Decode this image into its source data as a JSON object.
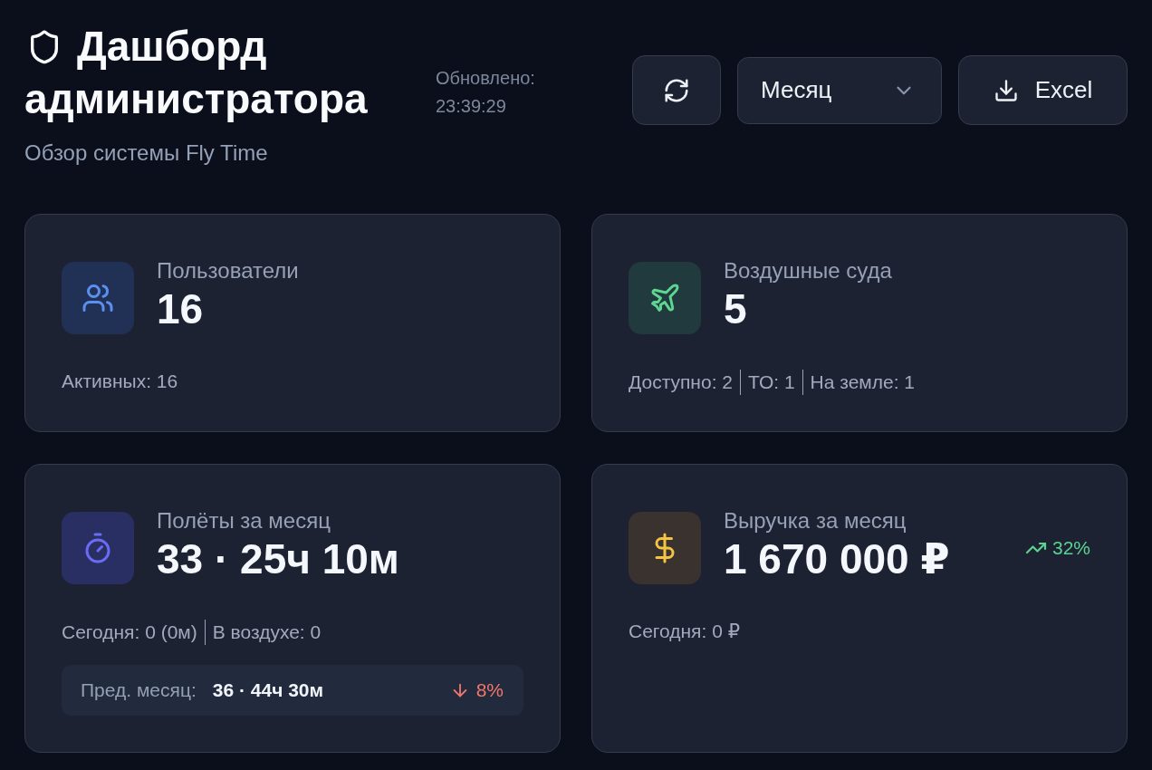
{
  "header": {
    "title_lines": [
      "Дашборд",
      "администратора"
    ],
    "subtitle": "Обзор системы Fly Time",
    "updated_label": "Обновлено:",
    "updated_time": "23:39:29"
  },
  "toolbar": {
    "period_select": {
      "value": "Месяц"
    },
    "export_button": {
      "label": "Excel"
    }
  },
  "stats": [
    {
      "kind": "users",
      "label": "Пользователи",
      "value": "16",
      "details": [
        "Активных: 16"
      ]
    },
    {
      "kind": "aircraft",
      "label": "Воздушные суда",
      "value": "5",
      "details": [
        "Доступно: 2",
        "ТО: 1",
        "На земле: 1"
      ]
    },
    {
      "kind": "flights",
      "label": "Полёты за месяц",
      "value": "33 · 25ч 10м",
      "details": [
        "Сегодня: 0 (0м)",
        "В воздухе: 0"
      ],
      "previous": {
        "label": "Пред. месяц:",
        "value": "36 · 44ч 30м",
        "rising": false,
        "change": "8%"
      }
    },
    {
      "kind": "revenue",
      "label": "Выручка за месяц",
      "value": "1 670 000 ₽",
      "trend": {
        "rising": true,
        "change": "32%"
      },
      "details": [
        "Сегодня: 0 ₽"
      ]
    }
  ]
}
